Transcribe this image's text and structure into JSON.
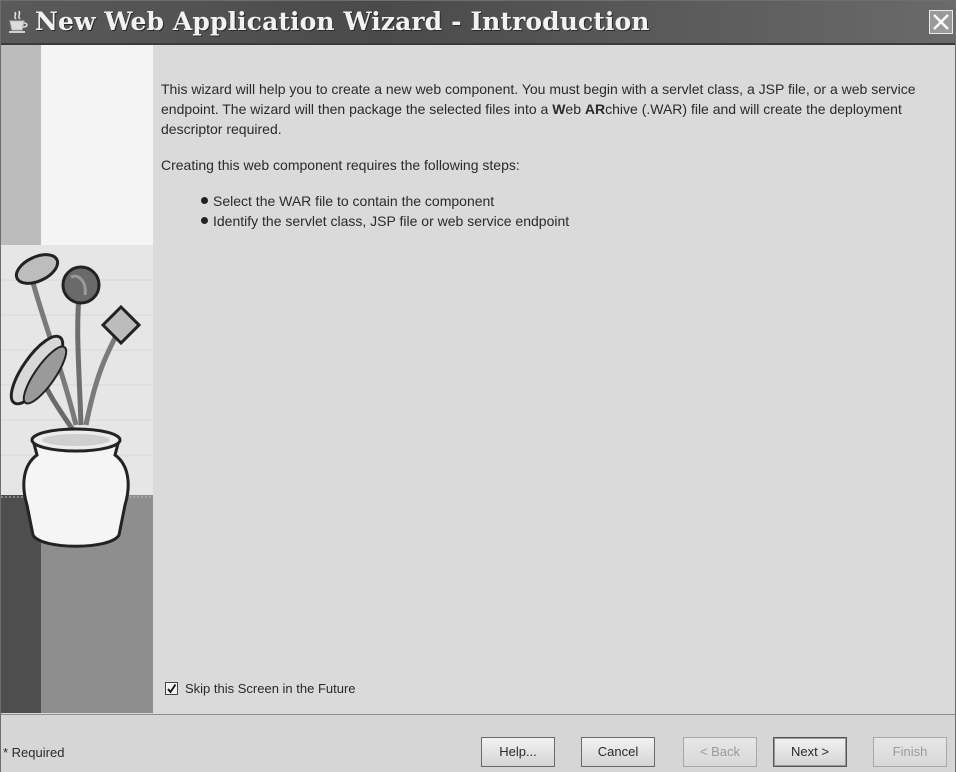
{
  "window": {
    "title": "New Web Application Wizard - Introduction"
  },
  "content": {
    "intro_part1": "This wizard will help you to create a new web component. You must begin with a servlet class, a JSP file, or a web service endpoint. The wizard will then package the selected files into a ",
    "intro_w": "W",
    "intro_eb": "eb ",
    "intro_ar": "AR",
    "intro_part2": "chive (.WAR) file and will create the deployment descriptor required.",
    "steps_heading": "Creating this web component requires the following steps:",
    "steps": [
      "Select the WAR file to contain the component",
      "Identify the servlet class, JSP file or web service endpoint"
    ],
    "skip_label": "Skip this Screen in the Future",
    "skip_checked": true
  },
  "footer": {
    "required_note": "* Required",
    "help": "Help...",
    "cancel": "Cancel",
    "back": "< Back",
    "next": "Next >",
    "finish": "Finish"
  },
  "icons": {
    "app": "java-cup-icon",
    "close": "close-icon"
  }
}
